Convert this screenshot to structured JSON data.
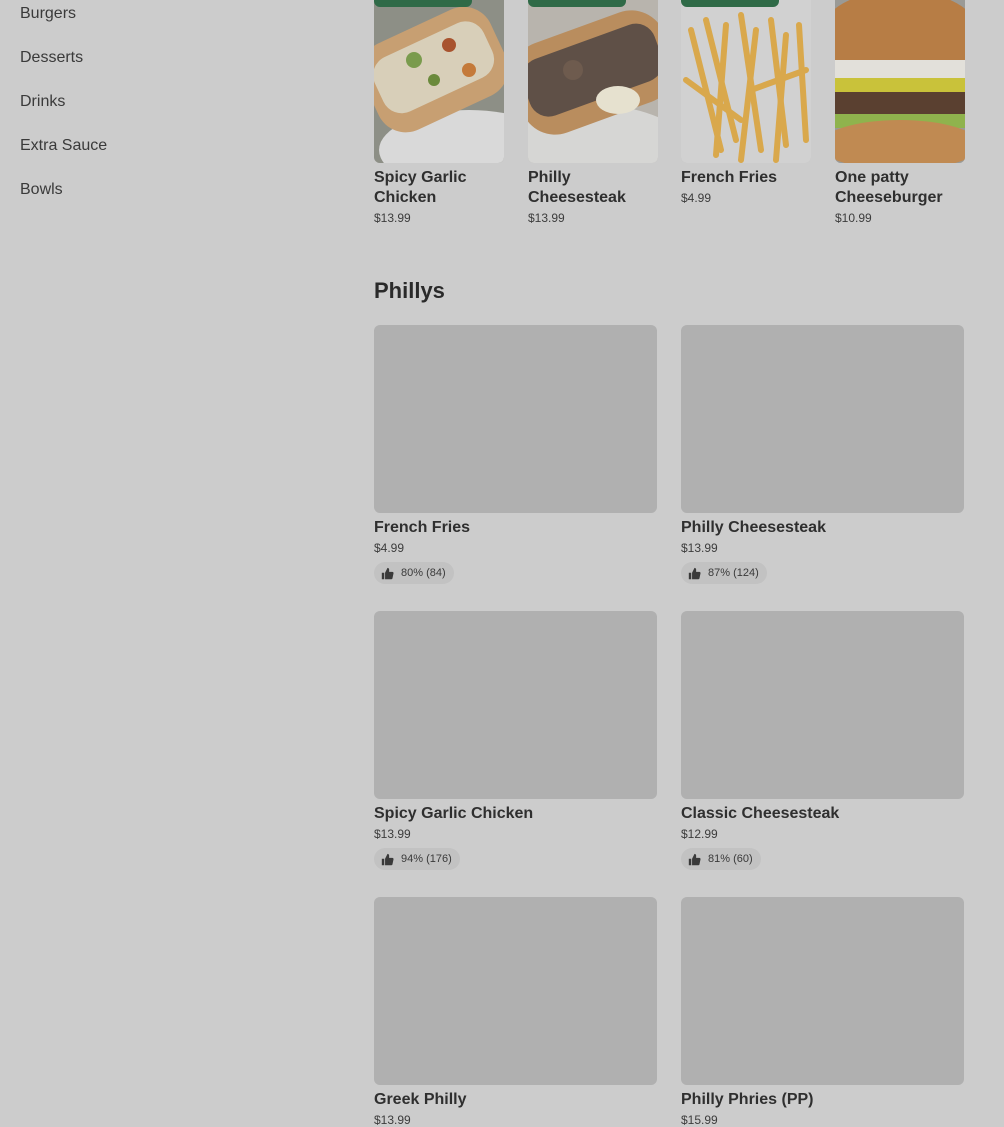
{
  "sidebar": {
    "items": [
      {
        "label": "Burgers"
      },
      {
        "label": "Desserts"
      },
      {
        "label": "Drinks"
      },
      {
        "label": "Extra Sauce"
      },
      {
        "label": "Bowls"
      }
    ]
  },
  "popular": {
    "items": [
      {
        "name": "Spicy Garlic Chicken",
        "price": "$13.99",
        "badge_color": "#2f6a47"
      },
      {
        "name": "Philly Cheesesteak",
        "price": "$13.99",
        "badge_color": "#2f6a47"
      },
      {
        "name": "French Fries",
        "price": "$4.99",
        "badge_color": "#2f6a47"
      },
      {
        "name": "One patty Cheeseburger",
        "price": "$10.99"
      }
    ]
  },
  "section": {
    "title": "Phillys"
  },
  "cards": [
    {
      "name": "French Fries",
      "price": "$4.99",
      "rating": "80% (84)"
    },
    {
      "name": "Philly Cheesesteak",
      "price": "$13.99",
      "rating": "87% (124)"
    },
    {
      "name": "Spicy Garlic Chicken",
      "price": "$13.99",
      "rating": "94% (176)"
    },
    {
      "name": "Classic Cheesesteak",
      "price": "$12.99",
      "rating": "81% (60)"
    },
    {
      "name": "Greek Philly",
      "price": "$13.99"
    },
    {
      "name": "Philly Phries (PP)",
      "price": "$15.99"
    }
  ],
  "icons": {
    "rating": "thumbs-up-icon"
  },
  "colors": {
    "overlay_background": "#cccccc",
    "badge": "#2f6a47",
    "placeholder": "#b0b0b0"
  }
}
